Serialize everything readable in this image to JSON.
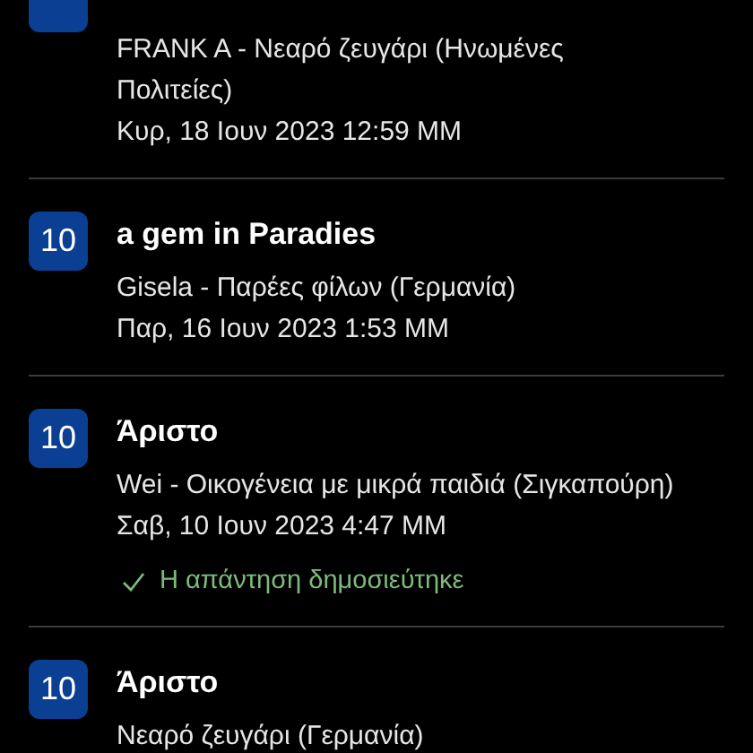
{
  "reviews": [
    {
      "author": "FRANK A - Νεαρό ζευγάρι (Ηνωμένες Πολιτείες)",
      "date": "Κυρ, 18 Ιουν 2023 12:59 ΜΜ"
    },
    {
      "score": "10",
      "title": "a gem in Paradies",
      "author": "Gisela - Παρέες φίλων (Γερμανία)",
      "date": "Παρ, 16 Ιουν 2023 1:53 ΜΜ"
    },
    {
      "score": "10",
      "title": "Άριστο",
      "author": "Wei - Οικογένεια με μικρά παιδιά (Σιγκαπούρη)",
      "date": "Σαβ, 10 Ιουν 2023 4:47 ΜΜ",
      "reply": "Η απάντηση δημοσιεύτηκε"
    },
    {
      "score": "10",
      "title": "Άριστο",
      "author": "Νεαρό ζευγάρι (Γερμανία)"
    }
  ]
}
